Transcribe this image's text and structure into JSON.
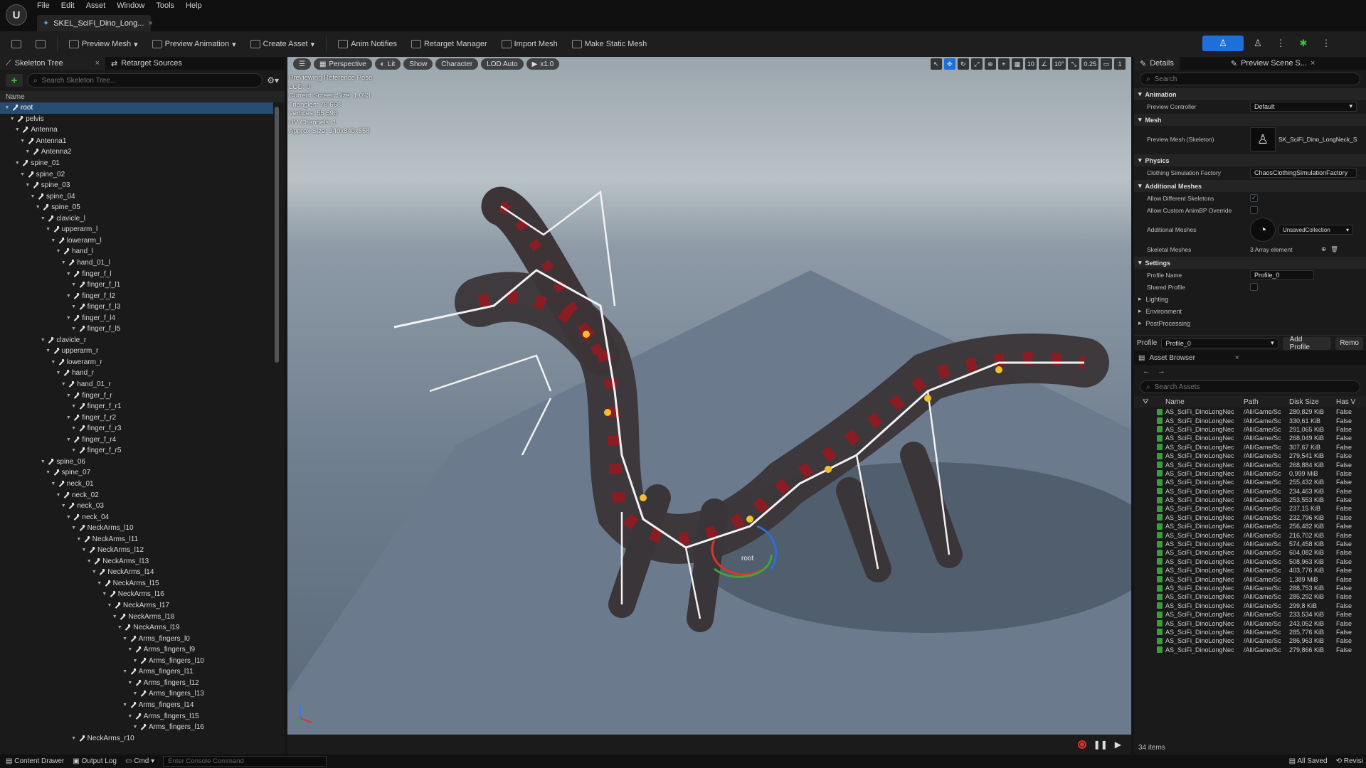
{
  "window": {
    "logo": "U",
    "menu": [
      "File",
      "Edit",
      "Asset",
      "Window",
      "Tools",
      "Help"
    ],
    "doc_tab": "SKEL_SciFi_Dino_Long..."
  },
  "toolbar": {
    "preview_mesh": "Preview Mesh",
    "preview_animation": "Preview Animation",
    "create_asset": "Create Asset",
    "anim_notifies": "Anim Notifies",
    "retarget_manager": "Retarget Manager",
    "import_mesh": "Import Mesh",
    "make_static_mesh": "Make Static Mesh"
  },
  "left_panel": {
    "tab_skeleton_tree": "Skeleton Tree",
    "tab_retarget_sources": "Retarget Sources",
    "search_placeholder": "Search Skeleton Tree...",
    "column_name": "Name",
    "bones": [
      {
        "d": 0,
        "n": "root",
        "sel": true
      },
      {
        "d": 1,
        "n": "pelvis"
      },
      {
        "d": 2,
        "n": "Antenna"
      },
      {
        "d": 3,
        "n": "Antenna1"
      },
      {
        "d": 4,
        "n": "Antenna2"
      },
      {
        "d": 2,
        "n": "spine_01"
      },
      {
        "d": 3,
        "n": "spine_02"
      },
      {
        "d": 4,
        "n": "spine_03"
      },
      {
        "d": 5,
        "n": "spine_04"
      },
      {
        "d": 6,
        "n": "spine_05"
      },
      {
        "d": 7,
        "n": "clavicle_l"
      },
      {
        "d": 8,
        "n": "upperarm_l"
      },
      {
        "d": 9,
        "n": "lowerarm_l"
      },
      {
        "d": 10,
        "n": "hand_l"
      },
      {
        "d": 11,
        "n": "hand_01_l"
      },
      {
        "d": 12,
        "n": "finger_f_l"
      },
      {
        "d": 13,
        "n": "finger_f_l1"
      },
      {
        "d": 12,
        "n": "finger_f_l2"
      },
      {
        "d": 13,
        "n": "finger_f_l3"
      },
      {
        "d": 12,
        "n": "finger_f_l4"
      },
      {
        "d": 13,
        "n": "finger_f_l5"
      },
      {
        "d": 7,
        "n": "clavicle_r"
      },
      {
        "d": 8,
        "n": "upperarm_r"
      },
      {
        "d": 9,
        "n": "lowerarm_r"
      },
      {
        "d": 10,
        "n": "hand_r"
      },
      {
        "d": 11,
        "n": "hand_01_r"
      },
      {
        "d": 12,
        "n": "finger_f_r"
      },
      {
        "d": 13,
        "n": "finger_f_r1"
      },
      {
        "d": 12,
        "n": "finger_f_r2"
      },
      {
        "d": 13,
        "n": "finger_f_r3"
      },
      {
        "d": 12,
        "n": "finger_f_r4"
      },
      {
        "d": 13,
        "n": "finger_f_r5"
      },
      {
        "d": 7,
        "n": "spine_06"
      },
      {
        "d": 8,
        "n": "spine_07"
      },
      {
        "d": 9,
        "n": "neck_01"
      },
      {
        "d": 10,
        "n": "neck_02"
      },
      {
        "d": 11,
        "n": "neck_03"
      },
      {
        "d": 12,
        "n": "neck_04"
      },
      {
        "d": 13,
        "n": "NeckArms_l10"
      },
      {
        "d": 14,
        "n": "NeckArms_l11"
      },
      {
        "d": 15,
        "n": "NeckArms_l12"
      },
      {
        "d": 16,
        "n": "NeckArms_l13"
      },
      {
        "d": 17,
        "n": "NeckArms_l14"
      },
      {
        "d": 18,
        "n": "NeckArms_l15"
      },
      {
        "d": 19,
        "n": "NeckArms_l16"
      },
      {
        "d": 20,
        "n": "NeckArms_l17"
      },
      {
        "d": 21,
        "n": "NeckArms_l18"
      },
      {
        "d": 22,
        "n": "NeckArms_l19"
      },
      {
        "d": 23,
        "n": "Arms_fingers_l0"
      },
      {
        "d": 24,
        "n": "Arms_fingers_l9"
      },
      {
        "d": 25,
        "n": "Arms_fingers_l10"
      },
      {
        "d": 23,
        "n": "Arms_fingers_l11"
      },
      {
        "d": 24,
        "n": "Arms_fingers_l12"
      },
      {
        "d": 25,
        "n": "Arms_fingers_l13"
      },
      {
        "d": 23,
        "n": "Arms_fingers_l14"
      },
      {
        "d": 24,
        "n": "Arms_fingers_l15"
      },
      {
        "d": 25,
        "n": "Arms_fingers_l16"
      },
      {
        "d": 13,
        "n": "NeckArms_r10"
      }
    ]
  },
  "viewport": {
    "perspective": "Perspective",
    "lit": "Lit",
    "show": "Show",
    "character": "Character",
    "lod": "LOD Auto",
    "speed": "x1.0",
    "grid_size": "10",
    "rot_snap": "10°",
    "scale_snap": "0.25",
    "cam_speed": "1",
    "info": [
      "Previewing Reference Pose",
      "LOD: 0",
      "Current Screen Size: 1.093",
      "Triangles: 78 668",
      "Vertices: 55 596",
      "UV Channels: 1",
      "Approx Size: 340x840x558"
    ],
    "root_label": "root"
  },
  "details": {
    "tab_details": "Details",
    "tab_preview_scene": "Preview Scene S...",
    "search_placeholder": "Search",
    "cat_animation": "Animation",
    "preview_controller_label": "Preview Controller",
    "preview_controller_value": "Default",
    "cat_mesh": "Mesh",
    "preview_mesh_label": "Preview Mesh (Skeleton)",
    "preview_mesh_value": "SK_SciFi_Dino_LongNeck_Skin",
    "cat_physics": "Physics",
    "clothing_label": "Clothing Simulation Factory",
    "clothing_value": "ChaosClothingSimulationFactory",
    "cat_additional": "Additional Meshes",
    "allow_diff_label": "Allow Different Skeletons",
    "allow_custom_label": "Allow Custom AnimBP Override",
    "additional_meshes_label": "Additional Meshes",
    "additional_meshes_value": "UnsavedCollection",
    "skeletal_meshes_label": "Skeletal Meshes",
    "skeletal_meshes_value": "3 Array element",
    "cat_settings": "Settings",
    "profile_name_label": "Profile Name",
    "profile_name_value": "Profile_0",
    "shared_profile_label": "Shared Profile",
    "sub_lighting": "Lighting",
    "sub_environment": "Environment",
    "sub_postprocessing": "PostProcessing",
    "profile_label": "Profile",
    "profile_value": "Profile_0",
    "add_profile": "Add Profile",
    "remove_profile": "Remo"
  },
  "asset_browser": {
    "tab": "Asset Browser",
    "search_placeholder": "Search Assets",
    "col_name": "Name",
    "col_path": "Path",
    "col_size": "Disk Size",
    "col_has": "Has V",
    "name_prefix": "AS_SciFi_DinoLongNec",
    "path_prefix": "/All/Game/Sc",
    "has_value": "False",
    "sizes": [
      "280,829 KiB",
      "330,61 KiB",
      "291,065 KiB",
      "268,049 KiB",
      "307,67 KiB",
      "279,541 KiB",
      "268,884 KiB",
      "0,999 MiB",
      "255,432 KiB",
      "234,463 KiB",
      "253,553 KiB",
      "237,15 KiB",
      "232,796 KiB",
      "256,482 KiB",
      "216,702 KiB",
      "574,458 KiB",
      "604,082 KiB",
      "508,963 KiB",
      "403,776 KiB",
      "1,389 MiB",
      "288,753 KiB",
      "285,292 KiB",
      "299,8 KiB",
      "233,534 KiB",
      "243,052 KiB",
      "285,776 KiB",
      "286,963 KiB",
      "279,866 KiB"
    ],
    "count": "34 items"
  },
  "statusbar": {
    "content_drawer": "Content Drawer",
    "output_log": "Output Log",
    "cmd": "Cmd",
    "console_placeholder": "Enter Console Command",
    "all_saved": "All Saved",
    "revision": "Revisi"
  }
}
